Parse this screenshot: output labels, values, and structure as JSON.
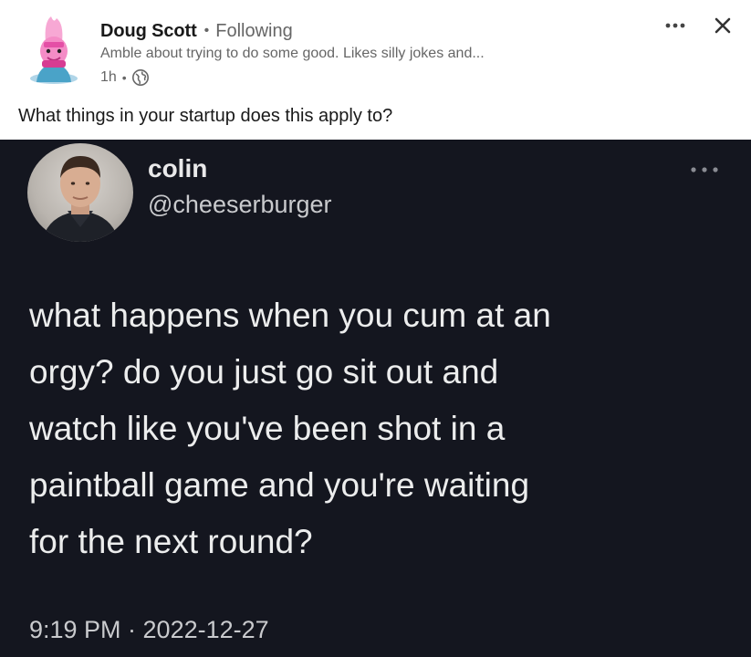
{
  "author": {
    "name": "Doug Scott",
    "follow_status": "Following",
    "headline": "Amble about trying to do some good. Likes silly jokes and...",
    "time": "1h",
    "visibility_icon": "globe-icon",
    "avatar_icon": "pink-character-avatar"
  },
  "post": {
    "text": "What things in your startup does this apply to?"
  },
  "actions": {
    "more_icon": "more-horizontal-icon",
    "close_icon": "close-icon"
  },
  "tweet": {
    "name": "colin",
    "handle": "@cheeserburger",
    "body_lines": [
      "what happens when you cum at an",
      "orgy? do you just go sit out and",
      "watch like you've been shot in a",
      "paintball game and you're waiting",
      "for the next round?"
    ],
    "timestamp": "9:19 PM · 2022-12-27"
  },
  "colors": {
    "tweet_background": "#14161f",
    "primary_text": "#191919",
    "secondary_text": "#666666"
  }
}
